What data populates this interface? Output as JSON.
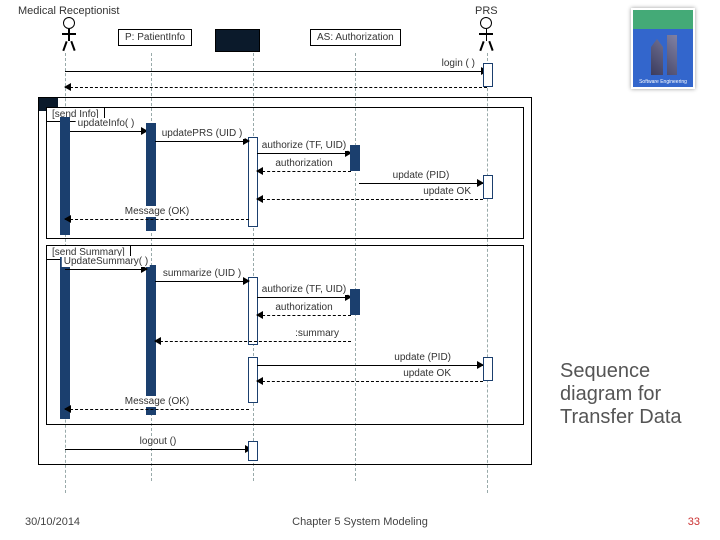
{
  "actors": {
    "left": "Medical Receptionist",
    "right": "PRS"
  },
  "objects": {
    "patient": "P: PatientInfo",
    "auth": "AS: Authorization"
  },
  "messages": {
    "login": "login ( )",
    "sendInfo": "[send Info]",
    "updateInfo": "updateInfo( )",
    "updatePRS1": "updatePRS (UID )",
    "authorize1": "authorize (TF, UID)",
    "authOK1": "authorization",
    "updatePID1": "update (PID)",
    "updateOK1": "update OK",
    "messageOK1": "Message (OK)",
    "sendSummary": "[send Summary]",
    "updateSummary": "UpdateSummary( )",
    "summarize": "summarize (UID )",
    "authorize2": "authorize (TF, UID)",
    "authOK2": "authorization",
    "summaryRet": ":summary",
    "updatePID2": "update (PID)",
    "updateOK2": "update OK",
    "messageOK2": "Message (OK)",
    "logout": "logout ()"
  },
  "title": "Sequence diagram for Transfer Data",
  "footer": {
    "date": "30/10/2014",
    "chapter": "Chapter 5 System Modeling",
    "page": "33"
  },
  "book": "Software Engineering"
}
